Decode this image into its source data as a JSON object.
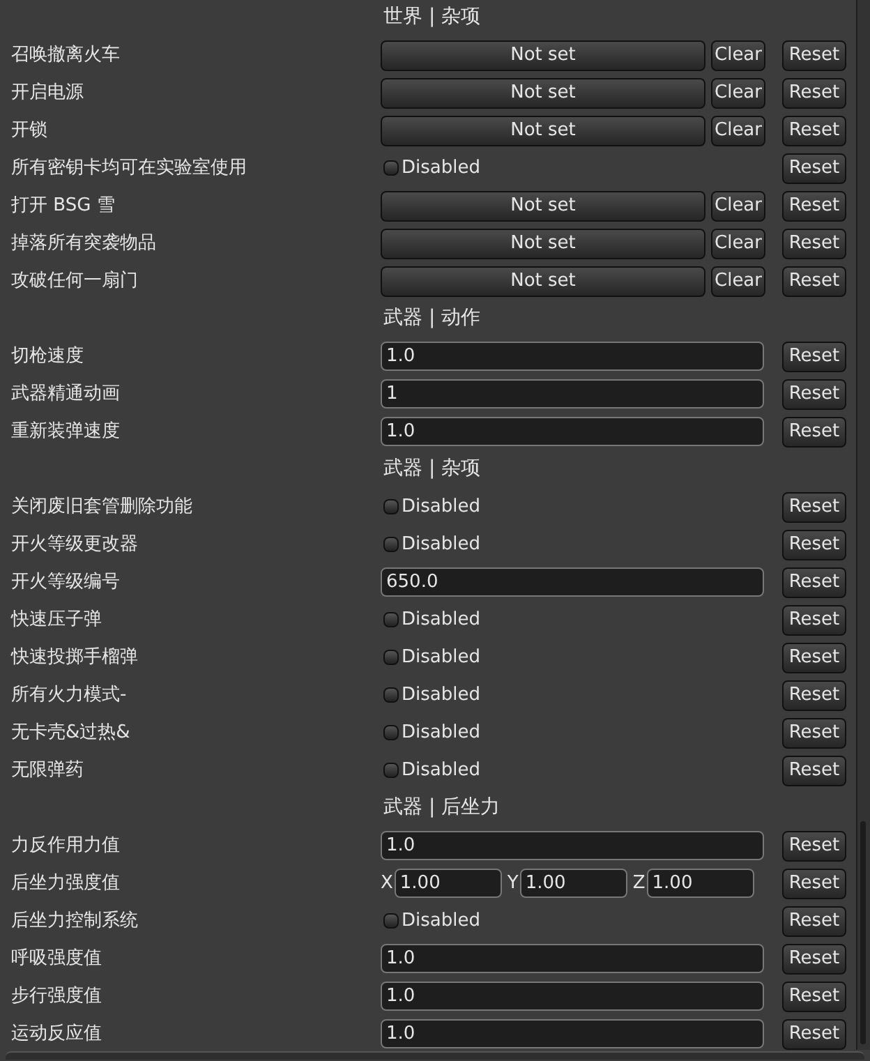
{
  "sections": [
    {
      "title": "世界 | 杂项",
      "rows": [
        {
          "label": "召唤撤离火车",
          "kind": "key",
          "value": "Not set",
          "clear": "Clear",
          "reset": "Reset"
        },
        {
          "label": "开启电源",
          "kind": "key",
          "value": "Not set",
          "clear": "Clear",
          "reset": "Reset"
        },
        {
          "label": "开锁",
          "kind": "key",
          "value": "Not set",
          "clear": "Clear",
          "reset": "Reset"
        },
        {
          "label": "所有密钥卡均可在实验室使用",
          "kind": "toggle",
          "value": "Disabled",
          "checked": false,
          "reset": "Reset"
        },
        {
          "label": "打开 BSG 雪",
          "kind": "key",
          "value": "Not set",
          "clear": "Clear",
          "reset": "Reset"
        },
        {
          "label": "掉落所有突袭物品",
          "kind": "key",
          "value": "Not set",
          "clear": "Clear",
          "reset": "Reset"
        },
        {
          "label": "攻破任何一扇门",
          "kind": "key",
          "value": "Not set",
          "clear": "Clear",
          "reset": "Reset"
        }
      ]
    },
    {
      "title": "武器 | 动作",
      "rows": [
        {
          "label": "切枪速度",
          "kind": "text",
          "value": "1.0",
          "reset": "Reset"
        },
        {
          "label": "武器精通动画",
          "kind": "text",
          "value": "1",
          "reset": "Reset"
        },
        {
          "label": "重新装弹速度",
          "kind": "text",
          "value": "1.0",
          "reset": "Reset"
        }
      ]
    },
    {
      "title": "武器 | 杂项",
      "rows": [
        {
          "label": "关闭废旧套管删除功能",
          "kind": "toggle",
          "value": "Disabled",
          "checked": false,
          "reset": "Reset"
        },
        {
          "label": "开火等级更改器",
          "kind": "toggle",
          "value": "Disabled",
          "checked": false,
          "reset": "Reset"
        },
        {
          "label": "开火等级编号",
          "kind": "text",
          "value": "650.0",
          "reset": "Reset"
        },
        {
          "label": "快速压子弹",
          "kind": "toggle",
          "value": "Disabled",
          "checked": false,
          "reset": "Reset"
        },
        {
          "label": "快速投掷手榴弹",
          "kind": "toggle",
          "value": "Disabled",
          "checked": false,
          "reset": "Reset"
        },
        {
          "label": "所有火力模式-",
          "kind": "toggle",
          "value": "Disabled",
          "checked": false,
          "reset": "Reset"
        },
        {
          "label": "无卡壳&过热&",
          "kind": "toggle",
          "value": "Disabled",
          "checked": false,
          "reset": "Reset"
        },
        {
          "label": "无限弹药",
          "kind": "toggle",
          "value": "Disabled",
          "checked": false,
          "reset": "Reset"
        }
      ]
    },
    {
      "title": "武器 | 后坐力",
      "rows": [
        {
          "label": "力反作用力值",
          "kind": "text",
          "value": "1.0",
          "reset": "Reset"
        },
        {
          "label": "后坐力强度值",
          "kind": "xyz",
          "axes": [
            {
              "axis": "X",
              "value": "1.00"
            },
            {
              "axis": "Y",
              "value": "1.00"
            },
            {
              "axis": "Z",
              "value": "1.00"
            }
          ],
          "reset": "Reset"
        },
        {
          "label": "后坐力控制系统",
          "kind": "toggle",
          "value": "Disabled",
          "checked": false,
          "reset": "Reset"
        },
        {
          "label": "呼吸强度值",
          "kind": "text",
          "value": "1.0",
          "reset": "Reset"
        },
        {
          "label": "步行强度值",
          "kind": "text",
          "value": "1.0",
          "reset": "Reset"
        },
        {
          "label": "运动反应值",
          "kind": "text",
          "value": "1.0",
          "reset": "Reset"
        }
      ]
    }
  ]
}
